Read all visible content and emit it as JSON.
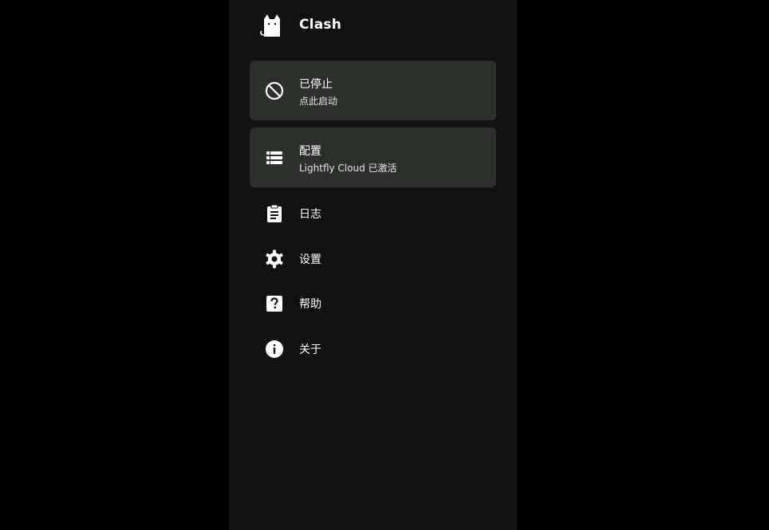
{
  "app": {
    "name": "Clash"
  },
  "status_card": {
    "title": "已停止",
    "subtitle": "点此启动",
    "icon": "block-icon"
  },
  "profile_card": {
    "title": "配置",
    "subtitle": "Lightfly Cloud 已激活",
    "icon": "list-icon"
  },
  "menu": {
    "items": [
      {
        "label": "日志",
        "icon": "clipboard-icon"
      },
      {
        "label": "设置",
        "icon": "gear-icon"
      },
      {
        "label": "帮助",
        "icon": "help-icon"
      },
      {
        "label": "关于",
        "icon": "info-icon"
      }
    ]
  },
  "colors": {
    "background": "#101110",
    "card": "#2d2f2d",
    "outer": "#000000",
    "text": "#ffffff"
  }
}
